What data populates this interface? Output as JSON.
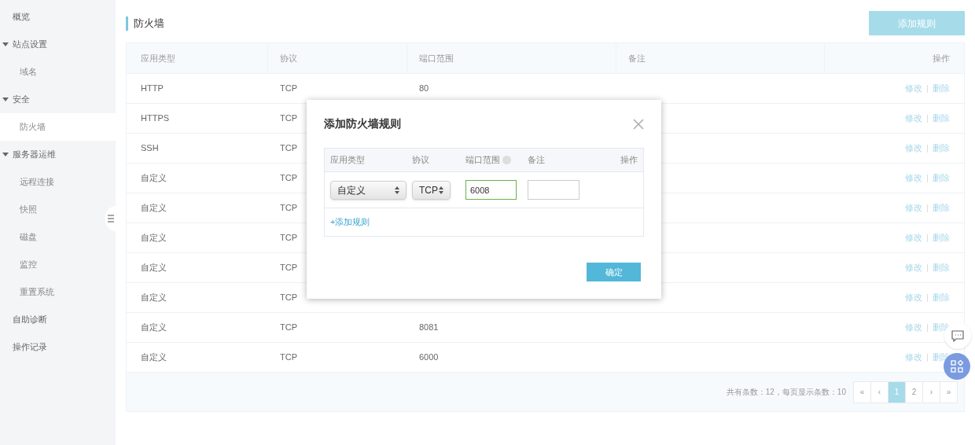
{
  "sidebar": {
    "items": [
      {
        "label": "概览",
        "selected": false
      },
      {
        "label": "站点设置",
        "expanded": true,
        "selected": false,
        "children": [
          {
            "label": "域名",
            "selected": false
          }
        ]
      },
      {
        "label": "安全",
        "expanded": true,
        "selected": false,
        "children": [
          {
            "label": "防火墙",
            "selected": true
          }
        ]
      },
      {
        "label": "服务器运维",
        "expanded": true,
        "selected": false,
        "children": [
          {
            "label": "远程连接",
            "selected": false
          },
          {
            "label": "快照",
            "selected": false
          },
          {
            "label": "磁盘",
            "selected": false
          },
          {
            "label": "监控",
            "selected": false
          },
          {
            "label": "重置系统",
            "selected": false
          }
        ]
      },
      {
        "label": "自助诊断",
        "selected": false
      },
      {
        "label": "操作记录",
        "selected": false
      }
    ]
  },
  "page": {
    "title": "防火墙",
    "add_button": "添加规则"
  },
  "table": {
    "columns": [
      "应用类型",
      "协议",
      "端口范围",
      "备注",
      "操作"
    ],
    "rows": [
      {
        "type": "HTTP",
        "protocol": "TCP",
        "port": "80",
        "actions": [
          "修改",
          "删除"
        ]
      },
      {
        "type": "HTTPS",
        "protocol": "TCP",
        "actions": [
          "修改",
          "删除"
        ]
      },
      {
        "type": "SSH",
        "protocol": "TCP",
        "actions": [
          "修改",
          "删除"
        ]
      },
      {
        "type": "自定义",
        "protocol": "TCP",
        "actions": [
          "修改",
          "删除"
        ]
      },
      {
        "type": "自定义",
        "protocol": "TCP",
        "actions": [
          "修改",
          "删除"
        ]
      },
      {
        "type": "自定义",
        "protocol": "TCP",
        "actions": [
          "修改",
          "删除"
        ]
      },
      {
        "type": "自定义",
        "protocol": "TCP",
        "actions": [
          "修改",
          "删除"
        ]
      },
      {
        "type": "自定义",
        "protocol": "TCP",
        "actions": [
          "修改",
          "删除"
        ]
      },
      {
        "type": "自定义",
        "protocol": "TCP",
        "port": "8081",
        "actions": [
          "修改",
          "删除"
        ]
      },
      {
        "type": "自定义",
        "protocol": "TCP",
        "port": "6000",
        "actions": [
          "修改",
          "删除"
        ]
      }
    ]
  },
  "pagination": {
    "summary": "共有条数：12，每页显示条数：10",
    "pages": [
      {
        "label": "«",
        "selected": false
      },
      {
        "label": "‹",
        "selected": false
      },
      {
        "label": "1",
        "selected": true
      },
      {
        "label": "2",
        "selected": false
      },
      {
        "label": "›",
        "selected": false
      },
      {
        "label": "»",
        "selected": false
      }
    ]
  },
  "dialog": {
    "title": "添加防火墙规则",
    "columns": [
      "应用类型",
      "协议",
      "端口范围",
      "备注",
      "操作"
    ],
    "row": {
      "type": "自定义",
      "protocol": "TCP",
      "port": "6008"
    },
    "add_link": "+添加规则",
    "confirm": "确定"
  }
}
